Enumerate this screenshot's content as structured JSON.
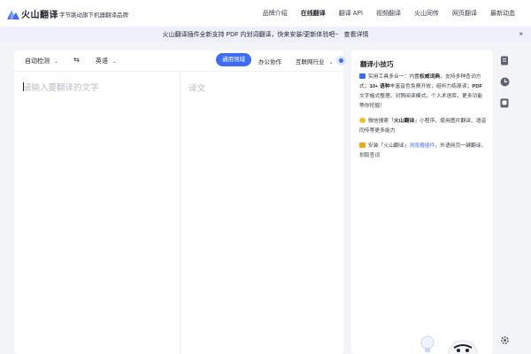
{
  "header": {
    "logo_text": "火山翻译",
    "slogan": "字节跳动旗下机器翻译品牌",
    "nav": [
      {
        "label": "品牌介绍",
        "active": false
      },
      {
        "label": "在线翻译",
        "active": true
      },
      {
        "label": "翻译 API",
        "active": false
      },
      {
        "label": "视频翻译",
        "active": false
      },
      {
        "label": "火山同传",
        "active": false
      },
      {
        "label": "网页翻译",
        "active": false
      },
      {
        "label": "最新动态",
        "active": false
      }
    ]
  },
  "banner": {
    "text": "火山翻译插件全新支持 PDF 内划词翻译，快来安装/更新体验吧~",
    "button": "查看详情",
    "close": "×"
  },
  "translator": {
    "source_lang": "自动检测",
    "target_lang": "英语",
    "domains": [
      "通用领域",
      "办公协作",
      "互联网行业"
    ],
    "input_placeholder": "请输入要翻译的文字",
    "output_placeholder": "译文"
  },
  "tips": {
    "title": "翻译小技巧",
    "tip1": {
      "pre": "实用工具多合一：内置",
      "b1": "权威词典",
      "mid1": "，支持多种查词方式；",
      "b2": "10+ 语种",
      "mid2": "丰富音色免费开放，组听力练原读；",
      "b3": "PDF",
      "post": "文字格式整理、对照阅读模式、个人术语库，更多功能等你挖掘！"
    },
    "tip2": {
      "pre": "微信搜索「",
      "b1": "火山翻译",
      "post": "」小程序，使用图片翻译、语音同传等更多能力"
    },
    "tip3": {
      "pre": "安装「火山翻译」",
      "link": "浏览器插件",
      "post": "，外语网页一键翻译，划取查词"
    }
  },
  "colors": {
    "accent": "#3c6df4",
    "banner_bg": "#eef1fb",
    "page_bg": "#f3f4f8"
  }
}
